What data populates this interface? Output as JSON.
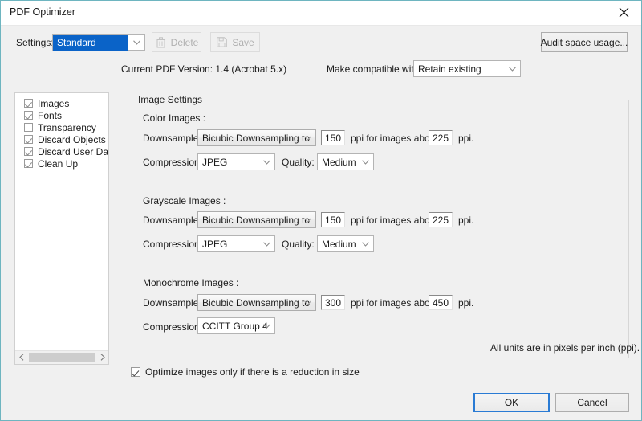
{
  "window": {
    "title": "PDF Optimizer",
    "close_icon": "close-icon",
    "accent": "#0a63c8",
    "border_color": "#6eb5c0"
  },
  "toolbar": {
    "settings_label": "Settings:",
    "settings_value": "Standard",
    "delete_label": "Delete",
    "delete_icon": "trash-icon",
    "save_label": "Save",
    "save_icon": "floppy-disk-icon",
    "audit_label": "Audit space usage...",
    "version_text": "Current PDF Version: 1.4 (Acrobat 5.x)",
    "compatible_label": "Make compatible with:",
    "compatible_value": "Retain existing"
  },
  "sidebar": {
    "items": [
      {
        "label": "Images",
        "checked": true
      },
      {
        "label": "Fonts",
        "checked": true
      },
      {
        "label": "Transparency",
        "checked": false
      },
      {
        "label": "Discard Objects",
        "checked": true
      },
      {
        "label": "Discard User Data",
        "checked": true
      },
      {
        "label": "Clean Up",
        "checked": true
      }
    ],
    "scroll_left_icon": "chevron-left-icon",
    "scroll_right_icon": "chevron-right-icon"
  },
  "image_settings": {
    "group_title": "Image Settings",
    "downsample_label": "Downsample:",
    "compression_label": "Compression:",
    "quality_label": "Quality:",
    "ppi_above_label": "ppi for images above",
    "ppi_label": "ppi.",
    "units_note": "All units are in pixels per inch (ppi).",
    "color": {
      "heading": "Color Images :",
      "downsample_value": "Bicubic Downsampling to",
      "downsample_ppi": "150",
      "threshold_ppi": "225",
      "compression_value": "JPEG",
      "quality_value": "Medium"
    },
    "grayscale": {
      "heading": "Grayscale Images :",
      "downsample_value": "Bicubic Downsampling to",
      "downsample_ppi": "150",
      "threshold_ppi": "225",
      "compression_value": "JPEG",
      "quality_value": "Medium"
    },
    "monochrome": {
      "heading": "Monochrome Images :",
      "downsample_value": "Bicubic Downsampling to",
      "downsample_ppi": "300",
      "threshold_ppi": "450",
      "compression_value": "CCITT Group 4"
    }
  },
  "footer": {
    "optimize_label": "Optimize images only if there is a reduction in size",
    "optimize_checked": true,
    "ok_label": "OK",
    "cancel_label": "Cancel"
  }
}
